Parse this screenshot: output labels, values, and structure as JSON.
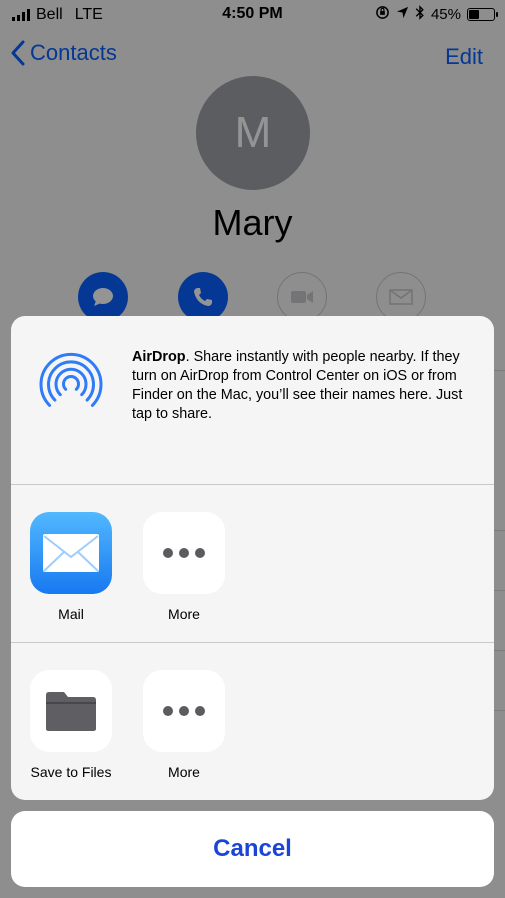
{
  "status_bar": {
    "carrier": "Bell",
    "network": "LTE",
    "time": "4:50 PM",
    "battery_percent": "45%",
    "battery_level": 0.45
  },
  "nav": {
    "back_label": "Contacts",
    "edit_label": "Edit"
  },
  "contact": {
    "initial": "M",
    "name": "Mary"
  },
  "share_sheet": {
    "airdrop": {
      "title": "AirDrop",
      "description": ". Share instantly with people nearby. If they turn on AirDrop from Control Center on iOS or from Finder on the Mac, you’ll see their names here. Just tap to share."
    },
    "app_row": [
      {
        "label": "Mail",
        "icon": "mail-icon"
      },
      {
        "label": "More",
        "icon": "more-icon"
      }
    ],
    "action_row": [
      {
        "label": "Save to Files",
        "icon": "folder-icon"
      },
      {
        "label": "More",
        "icon": "more-icon"
      }
    ],
    "cancel_label": "Cancel"
  },
  "colors": {
    "accent": "#0a60ff",
    "cancel_text": "#1a45d8",
    "airdrop_blue": "#2f7cf6"
  }
}
